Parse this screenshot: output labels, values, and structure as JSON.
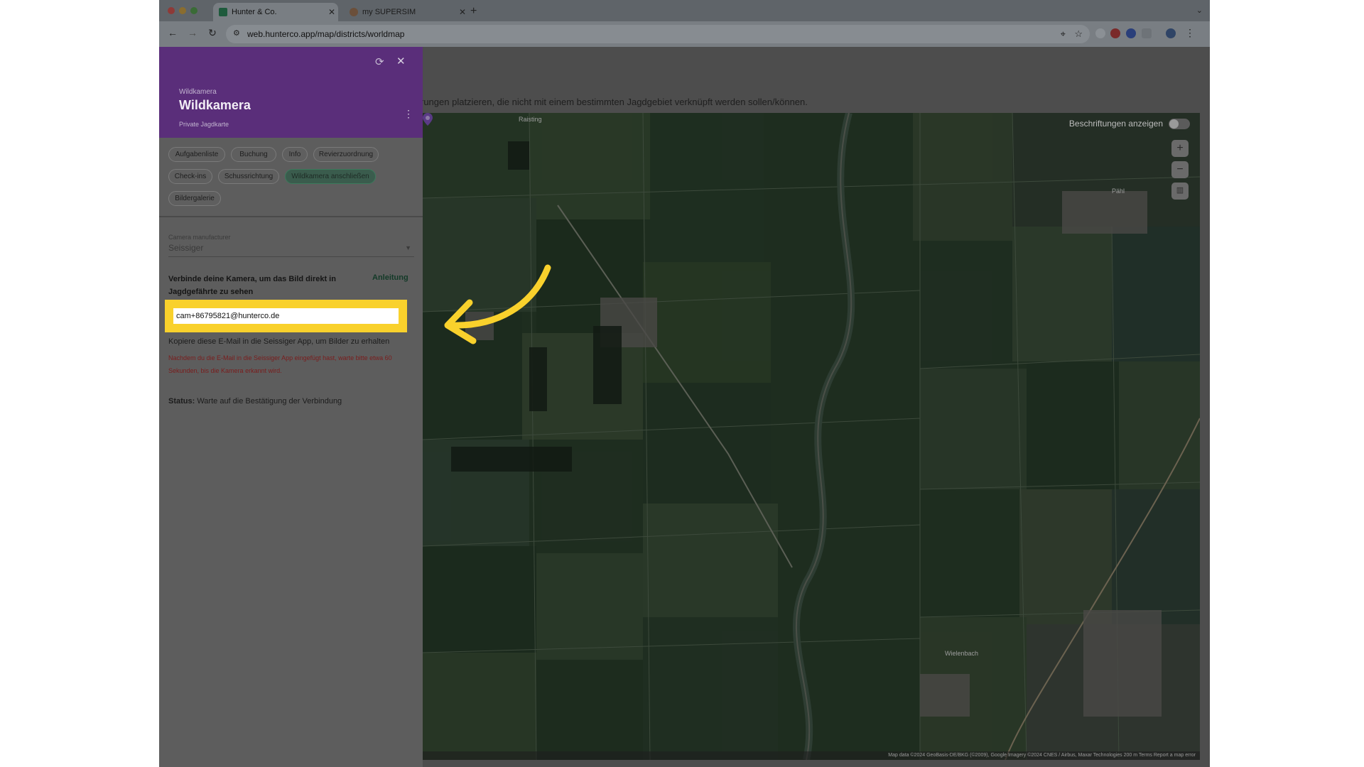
{
  "browser": {
    "tabs": [
      {
        "label": "Hunter & Co.",
        "active": true
      },
      {
        "label": "my SUPERSIM",
        "active": false
      }
    ],
    "new_tab": "+",
    "url": "web.hunterco.app/map/districts/worldmap"
  },
  "page": {
    "description": "rungen platzieren, die nicht mit einem bestimmten Jagdgebiet verknüpft werden sollen/können."
  },
  "panel": {
    "overline": "Wildkamera",
    "title": "Wildkamera",
    "subtitle": "Private Jagdkarte",
    "chips": [
      "Aufgabenliste",
      "Buchung",
      "Info",
      "Revierzuordnung",
      "Check-ins",
      "Schussrichtung",
      "Wildkamera anschließen",
      "Bildergalerie"
    ],
    "active_chip": "Wildkamera anschließen",
    "camera_manufacturer": {
      "label": "Camera manufacturer",
      "value": "Seissiger"
    },
    "connect_text": "Verbinde deine Kamera, um das Bild direkt in Jagdgefährte zu sehen",
    "guide_link": "Anleitung",
    "email": "cam+86795821@hunterco.de",
    "copy_hint": "Kopiere diese E-Mail in die Seissiger App, um Bilder zu erhalten",
    "wait_warning": "Nachdem du die E-Mail in die Seissiger App eingefügt hast, warte bitte etwa 60 Sekunden, bis die Kamera erkannt wird.",
    "status_label": "Status:",
    "status_value": " Warte auf die Bestätigung der Verbindung"
  },
  "map": {
    "labels_toggle": "Beschriftungen anzeigen",
    "labels_on": false,
    "zoom_in": "+",
    "zoom_out": "−",
    "place_names": [
      "Raisting",
      "Pähl",
      "Wielenbach"
    ],
    "attribution": "Map data ©2024 GeoBasis-DE/BKG (©2009), Google Imagery ©2024 CNES / Airbus, Maxar Technologies   200 m   Terms   Report a map error"
  },
  "colors": {
    "panel_header": "#5a2e7a",
    "accent_green": "#3b7a5c",
    "highlight_yellow": "#f9d12c",
    "warning_red": "#7a1c1c"
  }
}
